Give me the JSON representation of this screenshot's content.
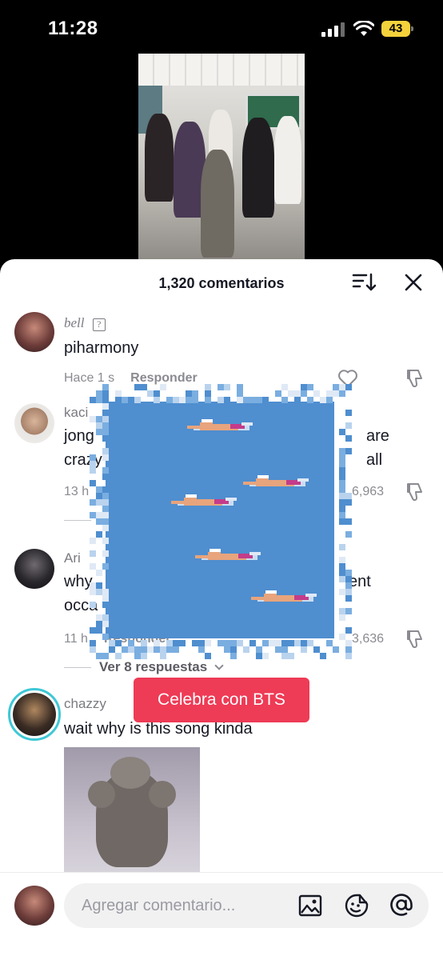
{
  "status": {
    "time": "11:28",
    "battery": "43"
  },
  "comments_header": {
    "title": "1,320 comentarios"
  },
  "comments": [
    {
      "username": "bell",
      "text": "piharmony",
      "time": "Hace 1 s",
      "reply_label": "Responder"
    },
    {
      "username": "kaci",
      "text_line1": "jong",
      "text_line1_tail": "are all",
      "text_line2": "crazy",
      "time": "13 h",
      "likes": "6,963"
    },
    {
      "username": "Ari",
      "text_line1": "why",
      "text_line1_tail": "ent",
      "text_line2": "occa",
      "time": "11 h",
      "reply_label": "Responder",
      "likes": "3,636",
      "replies": "Ver 8 respuestas"
    },
    {
      "username": "chazzy",
      "text": "wait why is this song kinda"
    }
  ],
  "cta": {
    "label": "Celebra con BTS"
  },
  "input": {
    "placeholder": "Agregar comentario..."
  }
}
